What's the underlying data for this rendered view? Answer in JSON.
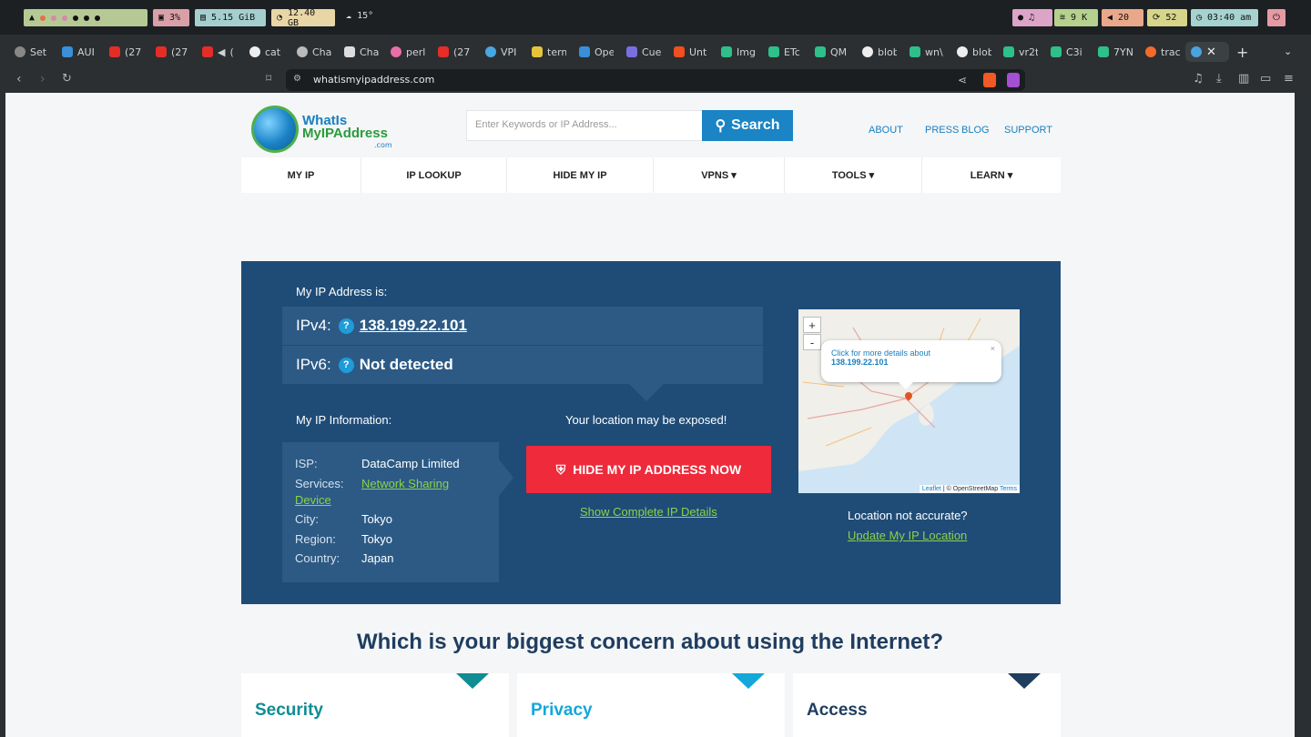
{
  "system_bar": {
    "cpu": "3%",
    "memory": "5.15 GiB",
    "disk": "12.40 GB",
    "weather": "15°",
    "network": "9 K",
    "volume": "20",
    "updates": "52",
    "clock": "03:40 am"
  },
  "tabs": [
    {
      "label": "Set",
      "icon": "gear-icon"
    },
    {
      "label": "AUI",
      "icon": "arch-icon"
    },
    {
      "label": "(27",
      "icon": "youtube-icon"
    },
    {
      "label": "(27",
      "icon": "youtube-icon"
    },
    {
      "label": "(",
      "icon": "youtube-icon"
    },
    {
      "label": "cat",
      "icon": "github-icon"
    },
    {
      "label": "Cha",
      "icon": "openai-icon"
    },
    {
      "label": "Cha",
      "icon": "openai-icon"
    },
    {
      "label": "perl",
      "icon": "perplexity-icon"
    },
    {
      "label": "(27",
      "icon": "youtube-icon"
    },
    {
      "label": "VPI",
      "icon": "globe-icon"
    },
    {
      "label": "term",
      "icon": "note-icon"
    },
    {
      "label": "Ope",
      "icon": "arch-icon"
    },
    {
      "label": "Cue",
      "icon": "vue-icon"
    },
    {
      "label": "Unt",
      "icon": "figma-icon"
    },
    {
      "label": "Img",
      "icon": "app-icon"
    },
    {
      "label": "ETc",
      "icon": "app-icon"
    },
    {
      "label": "QM",
      "icon": "app-icon"
    },
    {
      "label": "blob",
      "icon": "github-icon"
    },
    {
      "label": "wn\\",
      "icon": "app-icon"
    },
    {
      "label": "blob",
      "icon": "github-icon"
    },
    {
      "label": "vr2t",
      "icon": "app-icon"
    },
    {
      "label": "C3i",
      "icon": "app-icon"
    },
    {
      "label": "7YN",
      "icon": "app-icon"
    },
    {
      "label": "trac",
      "icon": "brave-icon"
    }
  ],
  "address_bar": {
    "url": "whatismyipaddress.com"
  },
  "site": {
    "logo_line1": "WhatIs",
    "logo_line2": "MyIPAddress",
    "logo_com": ".com",
    "search_placeholder": "Enter Keywords or IP Address...",
    "search_button": "Search",
    "top_links": [
      "ABOUT",
      "PRESS",
      "BLOG",
      "SUPPORT"
    ],
    "nav": [
      "MY IP",
      "IP LOOKUP",
      "HIDE MY IP",
      "VPNS ▾",
      "TOOLS ▾",
      "LEARN ▾"
    ]
  },
  "ip": {
    "label": "My IP Address is:",
    "ipv4_label": "IPv4:",
    "ipv4_value": "138.199.22.101",
    "ipv6_label": "IPv6:",
    "ipv6_value": "Not detected",
    "help_icon": "?"
  },
  "info": {
    "label": "My IP Information:",
    "isp_k": "ISP:",
    "isp_v": "DataCamp Limited",
    "services_k": "Services:",
    "services_v1": "Network Sharing",
    "services_v2": "Device",
    "city_k": "City:",
    "city_v": "Tokyo",
    "region_k": "Region:",
    "region_v": "Tokyo",
    "country_k": "Country:",
    "country_v": "Japan"
  },
  "cta": {
    "exposed": "Your location may be exposed!",
    "hide_button": "HIDE MY IP ADDRESS NOW",
    "show_details": "Show Complete IP Details"
  },
  "map": {
    "zoom_in": "+",
    "zoom_out": "-",
    "popup_text": "Click for more details about",
    "popup_ip": "138.199.22.101",
    "popup_close": "×",
    "attrib_leaflet": "Leaflet",
    "attrib_osm": "| © OpenStreetMap",
    "attrib_terms": "Terms"
  },
  "location": {
    "question": "Location not accurate?",
    "update_link": "Update My IP Location"
  },
  "concern": {
    "heading": "Which is your biggest concern about using the Internet?",
    "cards": [
      {
        "title": "Security",
        "color": "#0f8d93"
      },
      {
        "title": "Privacy",
        "color": "#13a8d9"
      },
      {
        "title": "Access",
        "color": "#1f3d5f"
      }
    ]
  }
}
